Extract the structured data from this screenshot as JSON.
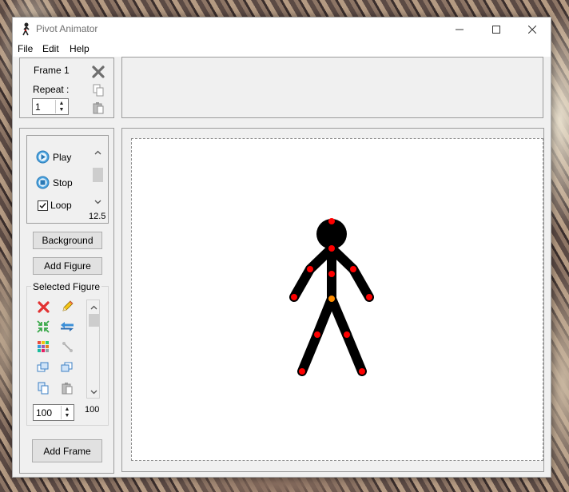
{
  "window": {
    "title": "Pivot Animator"
  },
  "menu": [
    "File",
    "Edit",
    "Help"
  ],
  "frame_panel": {
    "frame_label": "Frame 1",
    "repeat_label": "Repeat :",
    "repeat_value": "1"
  },
  "playback": {
    "play_label": "Play",
    "stop_label": "Stop",
    "loop_label": "Loop",
    "loop_checked": true,
    "speed_value": "12.5"
  },
  "buttons": {
    "background": "Background",
    "add_figure": "Add Figure",
    "add_frame": "Add Frame"
  },
  "selected_figure": {
    "title": "Selected Figure",
    "scale_input": "100",
    "scale_value": "100"
  },
  "figure": {
    "color": "#000000",
    "joint_color": "#ff0000",
    "root_color": "#ff8c00"
  }
}
